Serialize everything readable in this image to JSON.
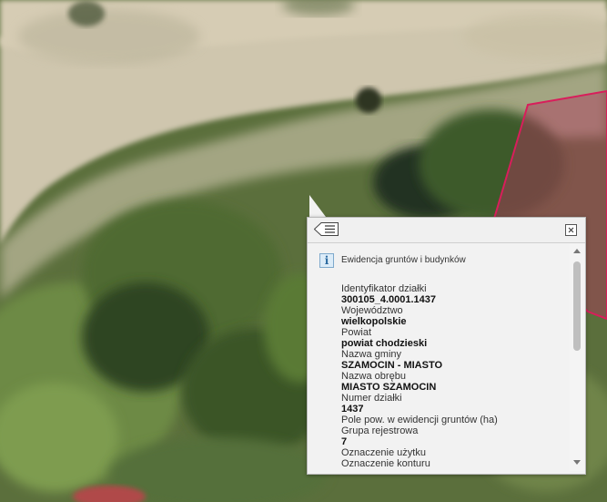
{
  "map": {
    "layer": "aerial-orthophoto",
    "parcel_outline_color": "#d81e5b"
  },
  "popup": {
    "list_icon": "list-icon",
    "close_icon": "close-icon",
    "info_icon": "info-icon",
    "info_glyph": "i",
    "layer_title": "Ewidencja gruntów i budynków",
    "fields": [
      {
        "label": "Identyfikator działki",
        "value": "300105_4.0001.1437"
      },
      {
        "label": "Województwo",
        "value": "wielkopolskie"
      },
      {
        "label": "Powiat",
        "value": "powiat chodzieski"
      },
      {
        "label": "Nazwa gminy",
        "value": "SZAMOCIN - MIASTO"
      },
      {
        "label": "Nazwa obrębu",
        "value": "MIASTO SZAMOCIN"
      },
      {
        "label": "Numer działki",
        "value": "1437"
      },
      {
        "label": "Pole pow. w ewidencji gruntów (ha)",
        "value": ""
      },
      {
        "label": "Grupa rejestrowa",
        "value": "7"
      },
      {
        "label": "Oznaczenie użytku",
        "value": ""
      },
      {
        "label": "Oznaczenie konturu",
        "value": ""
      }
    ]
  }
}
